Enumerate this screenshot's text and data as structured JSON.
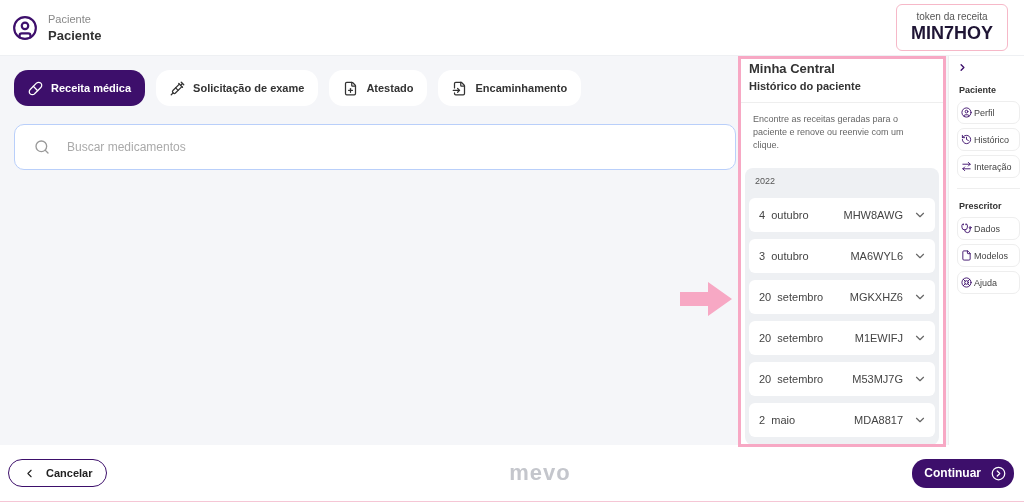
{
  "header": {
    "label": "Paciente",
    "name": "Paciente",
    "token": {
      "label": "token da receita",
      "value": "MIN7HOY"
    }
  },
  "tabs": [
    {
      "label": "Receita médica",
      "selected": true
    },
    {
      "label": "Solicitação de exame",
      "selected": false
    },
    {
      "label": "Atestado",
      "selected": false
    },
    {
      "label": "Encaminhamento",
      "selected": false
    }
  ],
  "search": {
    "placeholder": "Buscar medicamentos"
  },
  "history_panel": {
    "title": "Minha Central",
    "subtitle": "Histórico do paciente",
    "description": "Encontre as receitas geradas para o paciente e renove ou reenvie com um clique.",
    "year": "2022",
    "entries": [
      {
        "day": "4",
        "month": "outubro",
        "token": "MHW8AWG"
      },
      {
        "day": "3",
        "month": "outubro",
        "token": "MA6WYL6"
      },
      {
        "day": "20",
        "month": "setembro",
        "token": "MGKXHZ6"
      },
      {
        "day": "20",
        "month": "setembro",
        "token": "M1EWIFJ"
      },
      {
        "day": "20",
        "month": "setembro",
        "token": "M53MJ7G"
      },
      {
        "day": "2",
        "month": "maio",
        "token": "MDA8817"
      }
    ]
  },
  "sidebar": {
    "sections": [
      {
        "title": "Paciente",
        "items": [
          {
            "label": "Perfil"
          },
          {
            "label": "Histórico"
          },
          {
            "label": "Interação"
          }
        ]
      },
      {
        "title": "Prescritor",
        "items": [
          {
            "label": "Dados"
          },
          {
            "label": "Modelos"
          },
          {
            "label": "Ajuda"
          }
        ]
      }
    ]
  },
  "footer": {
    "cancel": "Cancelar",
    "logo": "mevo",
    "continue": "Continuar"
  }
}
